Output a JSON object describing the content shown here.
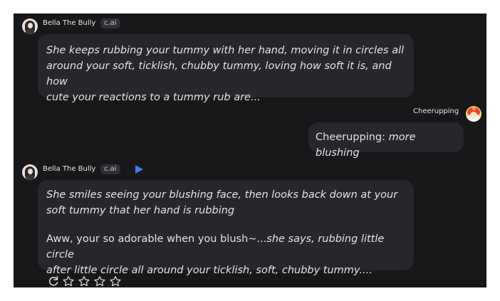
{
  "messages": [
    {
      "sender": "Bella The Bully",
      "badge": "c.ai",
      "lines": [
        "She keeps rubbing your tummy with her hand, moving it in circles all",
        "around your soft, ticklish, chubby tummy, loving how soft it is, and how",
        "cute your reactions to a tummy rub are..."
      ]
    },
    {
      "sender": "Cheerupping",
      "prefix": "Cheerupping: ",
      "italic": "more blushing"
    },
    {
      "sender": "Bella The Bully",
      "badge": "c.ai",
      "para1": [
        "She smiles seeing your blushing face, then looks back down at your",
        "soft tummy that her hand is rubbing"
      ],
      "para2_line1_plain": "Aww, your so adorable when you blush~...",
      "para2_line1_italic": "she says, rubbing little circle",
      "para2_line2_italic": "after little circle all around your ticklish, soft, chubby tummy...."
    }
  ],
  "colors": {
    "background": "#18181b",
    "bubble": "#27272b",
    "text": "#e4e4e7",
    "accent": "#3f7ef5"
  },
  "icons": [
    "play-icon",
    "refresh-icon",
    "star-icon"
  ],
  "rating": {
    "stars": 5,
    "filled": 0
  }
}
